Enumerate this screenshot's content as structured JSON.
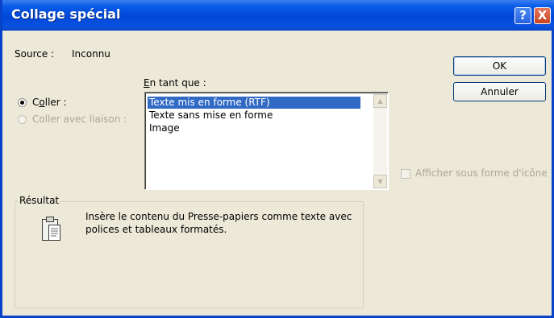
{
  "window": {
    "title": "Collage spécial",
    "help_glyph": "?",
    "close_glyph": "X"
  },
  "source": {
    "label": "Source :",
    "value": "Inconnu"
  },
  "paste_as": {
    "label_first": "E",
    "label_rest": "n tant que :"
  },
  "options": {
    "paste_prefix": "C",
    "paste_underlined": "o",
    "paste_rest": "ller :",
    "paste_link": "Coller avec liaison :",
    "paste_checked": true,
    "paste_link_enabled": false
  },
  "formats": [
    {
      "label": "Texte mis en forme (RTF)",
      "selected": true
    },
    {
      "label": "Texte sans mise en forme",
      "selected": false
    },
    {
      "label": "Image",
      "selected": false
    }
  ],
  "buttons": {
    "ok": "OK",
    "cancel": "Annuler"
  },
  "display_as_icon": {
    "label": "Afficher sous forme d'icône",
    "checked": false,
    "enabled": false
  },
  "result": {
    "legend": "Résultat",
    "line1": "Insère le contenu du Presse-papiers comme texte avec",
    "line2": "polices et tableaux formatés.",
    "icon": "clipboard-icon"
  },
  "scrollbar": {
    "up_glyph": "▲",
    "down_glyph": "▼"
  }
}
